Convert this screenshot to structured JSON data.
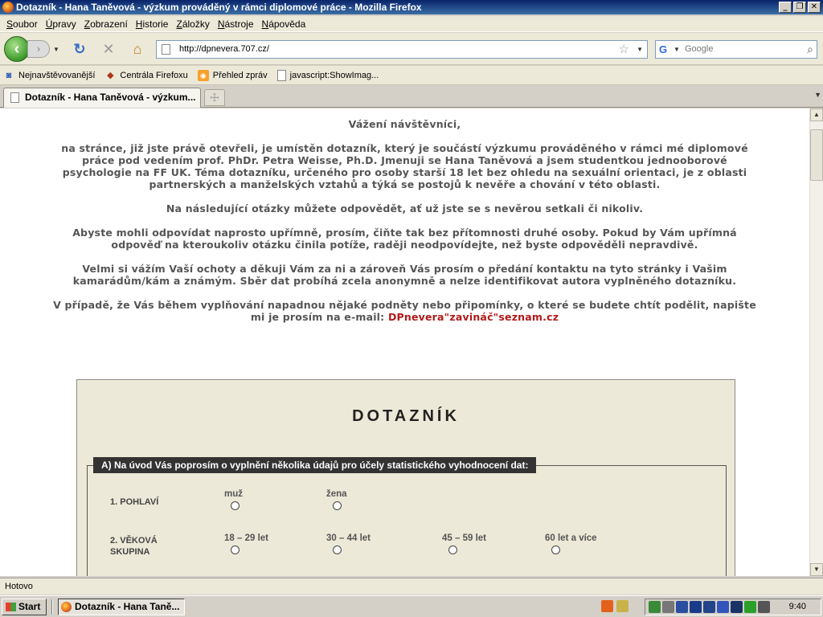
{
  "window": {
    "title": "Dotazník - Hana Taněvová - výzkum prováděný v rámci diplomové práce - Mozilla Firefox",
    "buttons": {
      "minimize": "_",
      "maximize": "❐",
      "close": "✕"
    }
  },
  "menu": [
    "Soubor",
    "Úpravy",
    "Zobrazení",
    "Historie",
    "Záložky",
    "Nástroje",
    "Nápověda"
  ],
  "nav": {
    "url": "http://dpnevera.707.cz/",
    "search_placeholder": "Google"
  },
  "bookmarks": [
    "Nejnavštěvovanější",
    "Centrála Firefoxu",
    "Přehled zpráv",
    "javascript:ShowImag..."
  ],
  "tab": {
    "label": "Dotazník - Hana Taněvová - výzkum..."
  },
  "page": {
    "greeting": "Vážení návštěvníci,",
    "para1": "na stránce, již jste právě otevřeli, je umístěn dotazník, který je součástí výzkumu prováděného v rámci mé diplomové práce pod vedením prof. PhDr. Petra Weisse, Ph.D. Jmenuji se Hana Taněvová a jsem studentkou jednooborové psychologie na FF UK. Téma dotazníku, určeného pro osoby starší 18 let bez ohledu na sexuální orientaci, je z oblasti partnerských a manželských vztahů a týká se postojů k nevěře a chování v této oblasti.",
    "para2": "Na následující otázky můžete odpovědět, ať už jste se s nevěrou setkali či nikoliv.",
    "para3": "Abyste mohli odpovídat naprosto upřímně, prosím, čiňte tak bez přítomnosti druhé osoby. Pokud by Vám upřímná odpověď na kteroukoliv otázku činila potíže, raději neodpovídejte, než byste odpověděli nepravdivě.",
    "para4": "Velmi si vážím Vaší ochoty a děkuji Vám za ni a zároveň Vás prosím o předání kontaktu na tyto stránky i Vašim kamarádům/kám a známým. Sběr dat probíhá zcela anonymně a nelze identifikovat autora vyplněného dotazníku.",
    "para5": "V případě, že Vás během vyplňování napadnou nějaké podněty nebo připomínky, o které se budete chtít podělit, napište mi je prosím na e-mail:",
    "email": "DPnevera\"zavináč\"seznam.cz"
  },
  "form": {
    "title": "DOTAZNÍK",
    "section_a": "A) Na úvod Vás poprosím o vyplnění několika údajů pro účely statistického vyhodnocení dat:",
    "q1": {
      "label": "1. POHLAVÍ",
      "options": [
        "muž",
        "žena"
      ]
    },
    "q2": {
      "label_line1": "2. VĚKOVÁ",
      "label_line2": "SKUPINA",
      "options": [
        "18 – 29 let",
        "30 – 44 let",
        "45 – 59 let",
        "60 let a více"
      ]
    }
  },
  "status": "Hotovo",
  "taskbar": {
    "start": "Start",
    "task": "Dotazník - Hana Taně...",
    "clock": "9:40"
  }
}
